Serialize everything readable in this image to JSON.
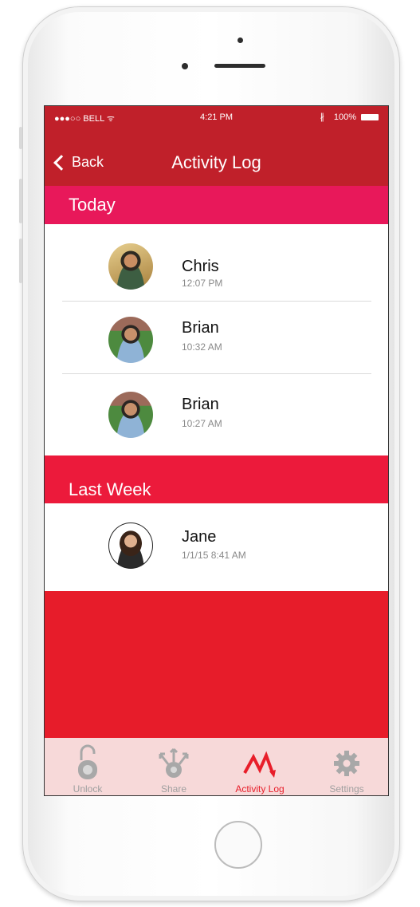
{
  "status_bar": {
    "carrier": "●●●○○ BELL ᯤ",
    "time": "4:21 PM",
    "bluetooth": "∦",
    "battery": "100%"
  },
  "nav": {
    "back_label": "Back",
    "title": "Activity Log"
  },
  "sections": [
    {
      "header": "Today",
      "entries": [
        {
          "name": "Chris",
          "time": "12:07 PM"
        },
        {
          "name": "Brian",
          "time": "10:32 AM"
        },
        {
          "name": "Brian",
          "time": "10:27 AM"
        }
      ]
    },
    {
      "header": "Last Week",
      "entries": [
        {
          "name": "Jane",
          "time": "1/1/15  8:41 AM"
        }
      ]
    }
  ],
  "tabs": [
    {
      "label": "Unlock",
      "icon": "lock-icon",
      "active": false
    },
    {
      "label": "Share",
      "icon": "share-icon",
      "active": false
    },
    {
      "label": "Activity Log",
      "icon": "activity-icon",
      "active": true
    },
    {
      "label": "Settings",
      "icon": "gear-icon",
      "active": false
    }
  ],
  "colors": {
    "nav_red": "#c0202a",
    "today_header": "#e8185a",
    "accent_red": "#e81e2a",
    "tab_bar_bg": "#f7d9d9"
  }
}
